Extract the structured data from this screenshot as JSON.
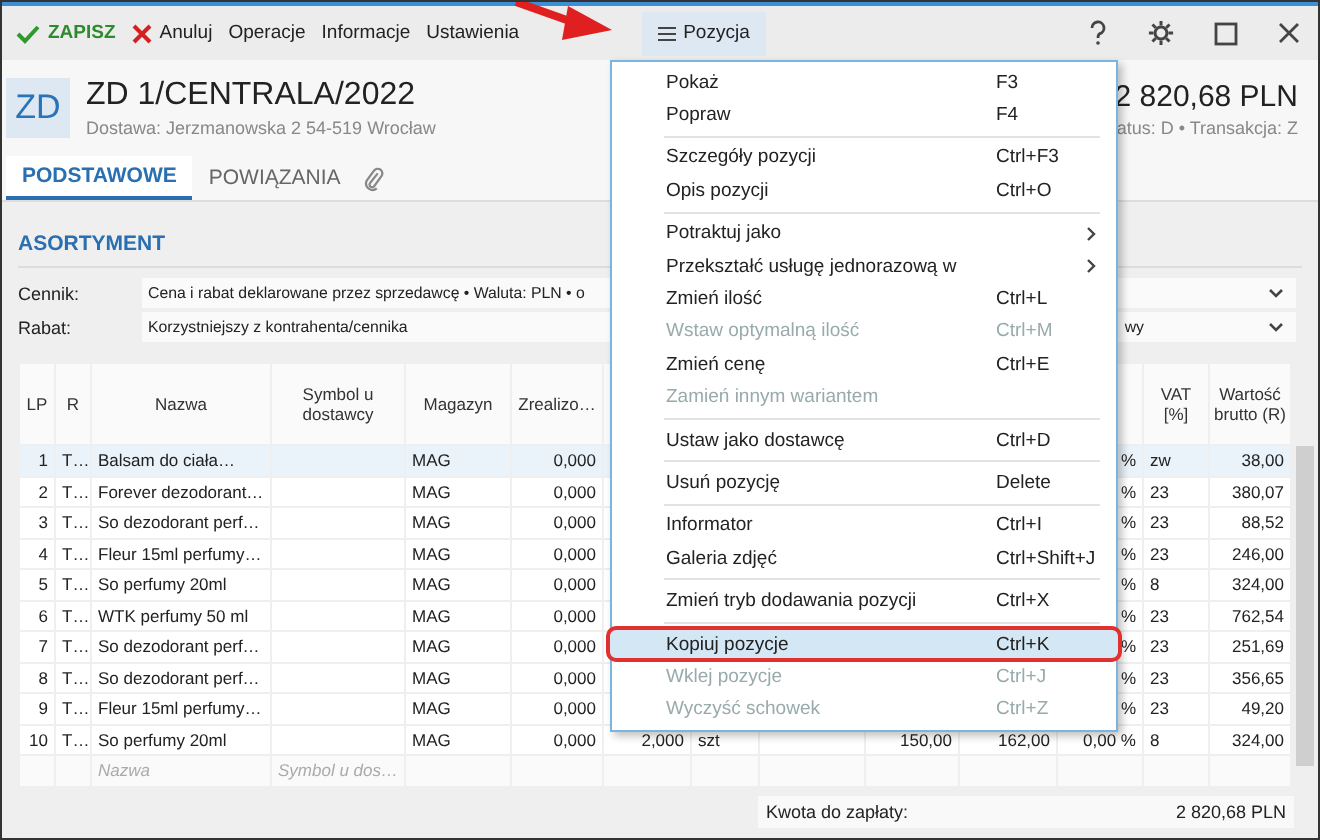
{
  "toolbar": {
    "save": "ZAPISZ",
    "cancel": "Anuluj",
    "menus": [
      "Operacje",
      "Informacje",
      "Ustawienia"
    ],
    "active_menu": {
      "label": "Pozycja",
      "selected": true
    }
  },
  "document": {
    "badge": "ZD",
    "title": "ZD 1/CENTRALA/2022",
    "subtitle": "Dostawa: Jerzmanowska 2 54-519 Wrocław",
    "total": "2 820,68 PLN",
    "status_line": "atus: D • Transakcja: Z"
  },
  "tabs": [
    {
      "label": "PODSTAWOWE",
      "selected": true
    },
    {
      "label": "POWIĄZANIA",
      "selected": false
    }
  ],
  "section": {
    "title": "ASORTYMENT"
  },
  "fields": [
    {
      "label": "Cennik:",
      "value": "Cena i rabat deklarowane przez sprzedawcę • Waluta: PLN • o"
    },
    {
      "label": "Rabat:",
      "value": "Korzystniejszy z kontrahenta/cennika",
      "tail": "wy"
    }
  ],
  "table": {
    "columns": [
      "LP",
      "R",
      "Nazwa",
      "Symbol u dostawcy",
      "Magazyn",
      "Zrealizo…",
      "VAT [%]",
      "Wartość brutto (R)"
    ],
    "rows": [
      {
        "selected": true,
        "lp": "1",
        "r": "T…",
        "name": "Balsam do ciała…",
        "warehouse": "MAG",
        "realized": "0,000",
        "discount": "%",
        "vat": "zw",
        "gross_value": "38,00"
      },
      {
        "selected": false,
        "lp": "2",
        "r": "T…",
        "name": "Forever dezodorant…",
        "warehouse": "MAG",
        "realized": "0,000",
        "discount": "%",
        "vat": "23",
        "gross_value": "380,07"
      },
      {
        "selected": false,
        "lp": "3",
        "r": "T…",
        "name": "So dezodorant perf…",
        "warehouse": "MAG",
        "realized": "0,000",
        "discount": "%",
        "vat": "23",
        "gross_value": "88,52"
      },
      {
        "selected": false,
        "lp": "4",
        "r": "T…",
        "name": "Fleur 15ml perfumy…",
        "warehouse": "MAG",
        "realized": "0,000",
        "discount": "%",
        "vat": "23",
        "gross_value": "246,00"
      },
      {
        "selected": false,
        "lp": "5",
        "r": "T…",
        "name": "So perfumy 20ml",
        "warehouse": "MAG",
        "realized": "0,000",
        "discount": "%",
        "vat": "8",
        "gross_value": "324,00"
      },
      {
        "selected": false,
        "lp": "6",
        "r": "T…",
        "name": "WTK perfumy 50 ml",
        "warehouse": "MAG",
        "realized": "0,000",
        "discount": "%",
        "vat": "23",
        "gross_value": "762,54"
      },
      {
        "selected": false,
        "lp": "7",
        "r": "T…",
        "name": "So dezodorant perf…",
        "warehouse": "MAG",
        "realized": "0,000",
        "discount": "%",
        "vat": "23",
        "gross_value": "251,69"
      },
      {
        "selected": false,
        "lp": "8",
        "r": "T…",
        "name": "So dezodorant perf…",
        "warehouse": "MAG",
        "realized": "0,000",
        "discount": "%",
        "vat": "23",
        "gross_value": "356,65"
      },
      {
        "selected": false,
        "lp": "9",
        "r": "T…",
        "name": "Fleur 15ml perfumy…",
        "warehouse": "MAG",
        "realized": "0,000",
        "discount": "%",
        "vat": "23",
        "gross_value": "49,20"
      },
      {
        "selected": false,
        "lp": "10",
        "r": "T…",
        "name": "So perfumy 20ml",
        "warehouse": "MAG",
        "realized": "0,000",
        "quantity": "2,000",
        "unit": "szt",
        "net_price": "150,00",
        "gross_price": "162,00",
        "discount": "0,00 %",
        "vat": "8",
        "gross_value": "324,00"
      }
    ],
    "new_row": {
      "name_placeholder": "Nazwa",
      "symbol_placeholder": "Symbol u dos…"
    }
  },
  "footer": {
    "label": "Kwota do zapłaty:",
    "value": "2 820,68 PLN"
  },
  "context_menu": [
    {
      "kind": "item",
      "label": "Pokaż",
      "shortcut": "F3",
      "disabled": false,
      "selected": false
    },
    {
      "kind": "item",
      "label": "Popraw",
      "shortcut": "F4",
      "disabled": false,
      "selected": false
    },
    {
      "kind": "separator"
    },
    {
      "kind": "item",
      "label": "Szczegóły pozycji",
      "shortcut": "Ctrl+F3",
      "disabled": false,
      "selected": false
    },
    {
      "kind": "item",
      "label": "Opis pozycji",
      "shortcut": "Ctrl+O",
      "disabled": false,
      "selected": false
    },
    {
      "kind": "separator"
    },
    {
      "kind": "submenu",
      "label": "Potraktuj jako",
      "disabled": false,
      "selected": false
    },
    {
      "kind": "submenu",
      "label": "Przekształć usługę jednorazową w",
      "disabled": false,
      "selected": false
    },
    {
      "kind": "item",
      "label": "Zmień ilość",
      "shortcut": "Ctrl+L",
      "disabled": false,
      "selected": false
    },
    {
      "kind": "item",
      "label": "Wstaw optymalną ilość",
      "shortcut": "Ctrl+M",
      "disabled": true,
      "selected": false
    },
    {
      "kind": "item",
      "label": "Zmień cenę",
      "shortcut": "Ctrl+E",
      "disabled": false,
      "selected": false
    },
    {
      "kind": "item",
      "label": "Zamień innym wariantem",
      "disabled": true,
      "selected": false
    },
    {
      "kind": "separator"
    },
    {
      "kind": "item",
      "label": "Ustaw jako dostawcę",
      "shortcut": "Ctrl+D",
      "disabled": false,
      "selected": false
    },
    {
      "kind": "separator"
    },
    {
      "kind": "item",
      "label": "Usuń pozycję",
      "shortcut": "Delete",
      "disabled": false,
      "selected": false
    },
    {
      "kind": "separator"
    },
    {
      "kind": "item",
      "label": "Informator",
      "shortcut": "Ctrl+I",
      "disabled": false,
      "selected": false
    },
    {
      "kind": "item",
      "label": "Galeria zdjęć",
      "shortcut": "Ctrl+Shift+J",
      "disabled": false,
      "selected": false
    },
    {
      "kind": "separator"
    },
    {
      "kind": "item",
      "label": "Zmień tryb dodawania pozycji",
      "shortcut": "Ctrl+X",
      "disabled": false,
      "selected": false
    },
    {
      "kind": "separator"
    },
    {
      "kind": "item",
      "label": "Kopiuj pozycje",
      "shortcut": "Ctrl+K",
      "disabled": false,
      "selected": true
    },
    {
      "kind": "item",
      "label": "Wklej pozycje",
      "shortcut": "Ctrl+J",
      "disabled": true,
      "selected": false
    },
    {
      "kind": "item",
      "label": "Wyczyść schowek",
      "shortcut": "Ctrl+Z",
      "disabled": true,
      "selected": false
    }
  ]
}
